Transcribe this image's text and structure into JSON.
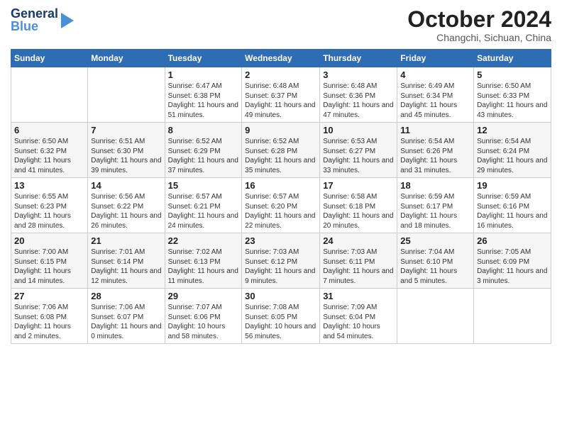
{
  "header": {
    "logo_line1": "General",
    "logo_line2": "Blue",
    "month": "October 2024",
    "location": "Changchi, Sichuan, China"
  },
  "weekdays": [
    "Sunday",
    "Monday",
    "Tuesday",
    "Wednesday",
    "Thursday",
    "Friday",
    "Saturday"
  ],
  "weeks": [
    [
      {
        "day": "",
        "info": ""
      },
      {
        "day": "",
        "info": ""
      },
      {
        "day": "1",
        "info": "Sunrise: 6:47 AM\nSunset: 6:38 PM\nDaylight: 11 hours and 51 minutes."
      },
      {
        "day": "2",
        "info": "Sunrise: 6:48 AM\nSunset: 6:37 PM\nDaylight: 11 hours and 49 minutes."
      },
      {
        "day": "3",
        "info": "Sunrise: 6:48 AM\nSunset: 6:36 PM\nDaylight: 11 hours and 47 minutes."
      },
      {
        "day": "4",
        "info": "Sunrise: 6:49 AM\nSunset: 6:34 PM\nDaylight: 11 hours and 45 minutes."
      },
      {
        "day": "5",
        "info": "Sunrise: 6:50 AM\nSunset: 6:33 PM\nDaylight: 11 hours and 43 minutes."
      }
    ],
    [
      {
        "day": "6",
        "info": "Sunrise: 6:50 AM\nSunset: 6:32 PM\nDaylight: 11 hours and 41 minutes."
      },
      {
        "day": "7",
        "info": "Sunrise: 6:51 AM\nSunset: 6:30 PM\nDaylight: 11 hours and 39 minutes."
      },
      {
        "day": "8",
        "info": "Sunrise: 6:52 AM\nSunset: 6:29 PM\nDaylight: 11 hours and 37 minutes."
      },
      {
        "day": "9",
        "info": "Sunrise: 6:52 AM\nSunset: 6:28 PM\nDaylight: 11 hours and 35 minutes."
      },
      {
        "day": "10",
        "info": "Sunrise: 6:53 AM\nSunset: 6:27 PM\nDaylight: 11 hours and 33 minutes."
      },
      {
        "day": "11",
        "info": "Sunrise: 6:54 AM\nSunset: 6:26 PM\nDaylight: 11 hours and 31 minutes."
      },
      {
        "day": "12",
        "info": "Sunrise: 6:54 AM\nSunset: 6:24 PM\nDaylight: 11 hours and 29 minutes."
      }
    ],
    [
      {
        "day": "13",
        "info": "Sunrise: 6:55 AM\nSunset: 6:23 PM\nDaylight: 11 hours and 28 minutes."
      },
      {
        "day": "14",
        "info": "Sunrise: 6:56 AM\nSunset: 6:22 PM\nDaylight: 11 hours and 26 minutes."
      },
      {
        "day": "15",
        "info": "Sunrise: 6:57 AM\nSunset: 6:21 PM\nDaylight: 11 hours and 24 minutes."
      },
      {
        "day": "16",
        "info": "Sunrise: 6:57 AM\nSunset: 6:20 PM\nDaylight: 11 hours and 22 minutes."
      },
      {
        "day": "17",
        "info": "Sunrise: 6:58 AM\nSunset: 6:18 PM\nDaylight: 11 hours and 20 minutes."
      },
      {
        "day": "18",
        "info": "Sunrise: 6:59 AM\nSunset: 6:17 PM\nDaylight: 11 hours and 18 minutes."
      },
      {
        "day": "19",
        "info": "Sunrise: 6:59 AM\nSunset: 6:16 PM\nDaylight: 11 hours and 16 minutes."
      }
    ],
    [
      {
        "day": "20",
        "info": "Sunrise: 7:00 AM\nSunset: 6:15 PM\nDaylight: 11 hours and 14 minutes."
      },
      {
        "day": "21",
        "info": "Sunrise: 7:01 AM\nSunset: 6:14 PM\nDaylight: 11 hours and 12 minutes."
      },
      {
        "day": "22",
        "info": "Sunrise: 7:02 AM\nSunset: 6:13 PM\nDaylight: 11 hours and 11 minutes."
      },
      {
        "day": "23",
        "info": "Sunrise: 7:03 AM\nSunset: 6:12 PM\nDaylight: 11 hours and 9 minutes."
      },
      {
        "day": "24",
        "info": "Sunrise: 7:03 AM\nSunset: 6:11 PM\nDaylight: 11 hours and 7 minutes."
      },
      {
        "day": "25",
        "info": "Sunrise: 7:04 AM\nSunset: 6:10 PM\nDaylight: 11 hours and 5 minutes."
      },
      {
        "day": "26",
        "info": "Sunrise: 7:05 AM\nSunset: 6:09 PM\nDaylight: 11 hours and 3 minutes."
      }
    ],
    [
      {
        "day": "27",
        "info": "Sunrise: 7:06 AM\nSunset: 6:08 PM\nDaylight: 11 hours and 2 minutes."
      },
      {
        "day": "28",
        "info": "Sunrise: 7:06 AM\nSunset: 6:07 PM\nDaylight: 11 hours and 0 minutes."
      },
      {
        "day": "29",
        "info": "Sunrise: 7:07 AM\nSunset: 6:06 PM\nDaylight: 10 hours and 58 minutes."
      },
      {
        "day": "30",
        "info": "Sunrise: 7:08 AM\nSunset: 6:05 PM\nDaylight: 10 hours and 56 minutes."
      },
      {
        "day": "31",
        "info": "Sunrise: 7:09 AM\nSunset: 6:04 PM\nDaylight: 10 hours and 54 minutes."
      },
      {
        "day": "",
        "info": ""
      },
      {
        "day": "",
        "info": ""
      }
    ]
  ]
}
